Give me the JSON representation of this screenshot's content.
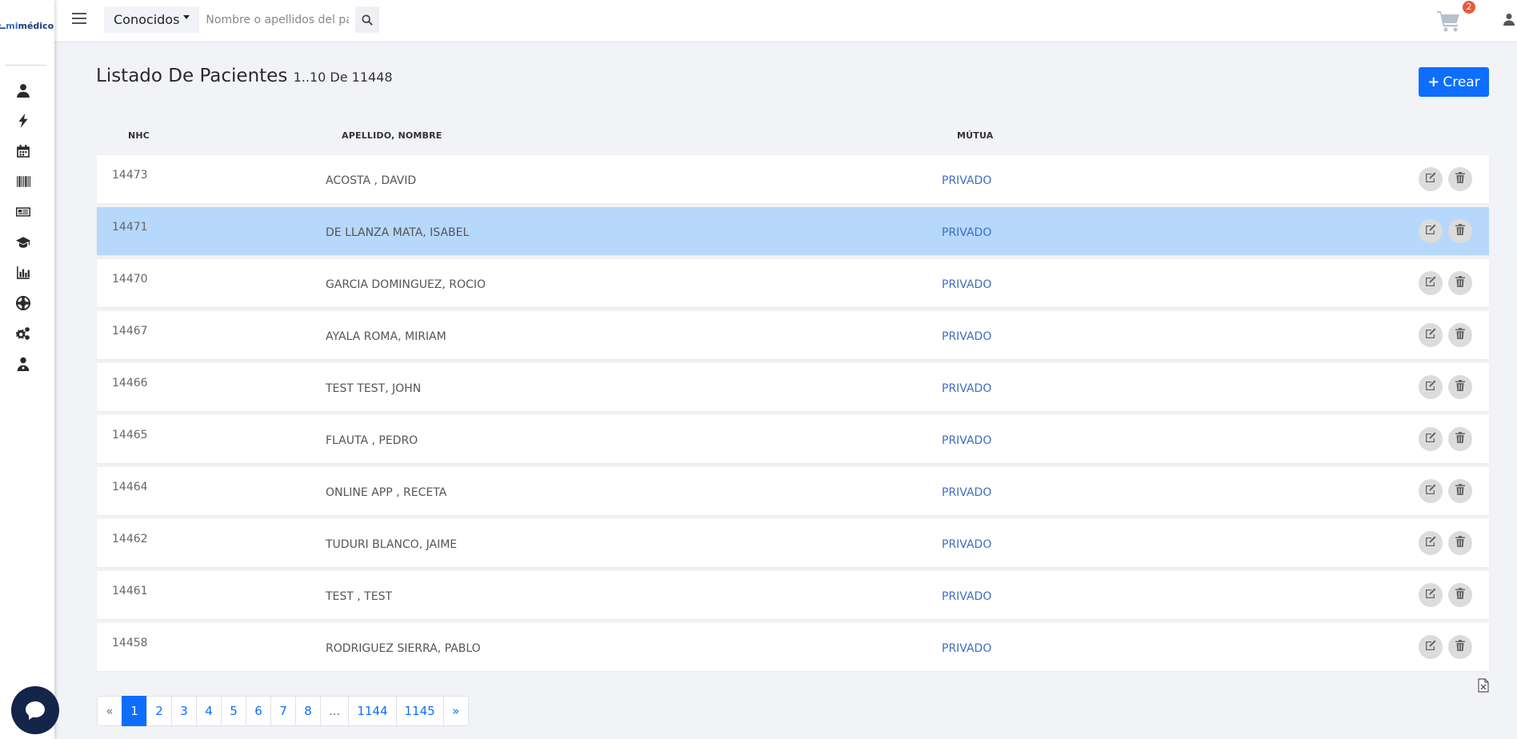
{
  "brand": {
    "logo_text": "mimédico",
    "logo_prefix": "mi",
    "logo_rest": "médico"
  },
  "sidebar": {
    "icons": [
      "user-icon",
      "bolt-icon",
      "calendar-icon",
      "barcode-icon",
      "newspaper-icon",
      "graduation-cap-icon",
      "bar-chart-icon",
      "lifebuoy-icon",
      "gears-icon",
      "user-doctor-icon"
    ]
  },
  "topbar": {
    "filter_label": "Conocidos",
    "search_placeholder": "Nombre o apellidos del paciente",
    "cart_count": "2"
  },
  "header": {
    "title": "Listado De Pacientes",
    "range": "1..10 De 11448",
    "create_label": "Crear"
  },
  "table": {
    "columns": [
      "NHC",
      "APELLIDO, NOMBRE",
      "MÚTUA"
    ],
    "rows": [
      {
        "nhc": "14473",
        "name": "ACOSTA , DAVID",
        "mutua": "PRIVADO"
      },
      {
        "nhc": "14471",
        "name": "DE LLANZA MATA, ISABEL",
        "mutua": "PRIVADO"
      },
      {
        "nhc": "14470",
        "name": "GARCIA DOMINGUEZ, ROCIO",
        "mutua": "PRIVADO"
      },
      {
        "nhc": "14467",
        "name": "AYALA ROMA, MIRIAM",
        "mutua": "PRIVADO"
      },
      {
        "nhc": "14466",
        "name": "TEST TEST, JOHN",
        "mutua": "PRIVADO"
      },
      {
        "nhc": "14465",
        "name": "FLAUTA , PEDRO",
        "mutua": "PRIVADO"
      },
      {
        "nhc": "14464",
        "name": "ONLINE APP , RECETA",
        "mutua": "PRIVADO"
      },
      {
        "nhc": "14462",
        "name": "TUDURI BLANCO, JAIME",
        "mutua": "PRIVADO"
      },
      {
        "nhc": "14461",
        "name": "TEST , TEST",
        "mutua": "PRIVADO"
      },
      {
        "nhc": "14458",
        "name": "RODRIGUEZ SIERRA, PABLO",
        "mutua": "PRIVADO"
      }
    ],
    "selected_row_index": 1
  },
  "pagination": [
    "«",
    "1",
    "2",
    "3",
    "4",
    "5",
    "6",
    "7",
    "8",
    "...",
    "1144",
    "1145",
    "»"
  ],
  "pagination_active": "1",
  "colors": {
    "accent": "#0d6efd",
    "selected_row": "#b6d8fb",
    "mutua_link": "#3b6ec2",
    "badge": "#e85a3c",
    "chat_bubble": "#14254a"
  }
}
